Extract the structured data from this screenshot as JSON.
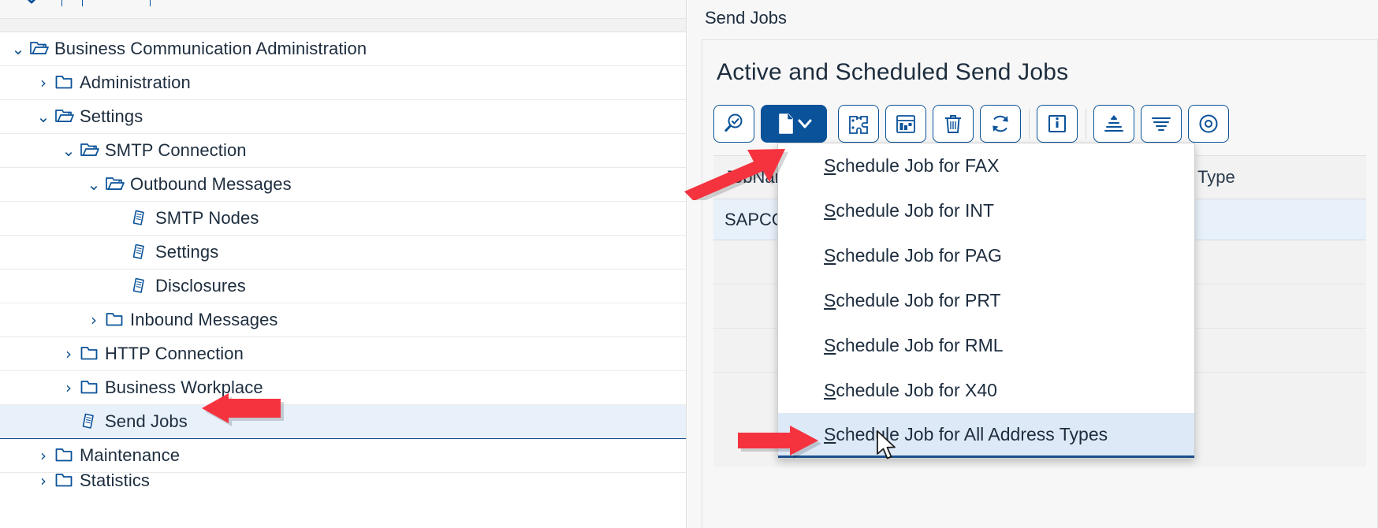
{
  "tree_toolbar": {
    "icons": [
      {
        "name": "collapse-all-icon",
        "glyph": "⌄"
      },
      {
        "name": "expand-all-icon",
        "glyph": "⌃"
      }
    ]
  },
  "tree": {
    "items": [
      {
        "label": "Business Communication Administration",
        "depth": 0,
        "twisty": "⌄",
        "icon": "open-folder",
        "selected": false
      },
      {
        "label": "Administration",
        "depth": 1,
        "twisty": "›",
        "icon": "closed-folder",
        "selected": false
      },
      {
        "label": "Settings",
        "depth": 1,
        "twisty": "⌄",
        "icon": "open-folder",
        "selected": false
      },
      {
        "label": "SMTP Connection",
        "depth": 2,
        "twisty": "⌄",
        "icon": "open-folder",
        "selected": false
      },
      {
        "label": "Outbound Messages",
        "depth": 3,
        "twisty": "⌄",
        "icon": "open-folder",
        "selected": false
      },
      {
        "label": "SMTP Nodes",
        "depth": 4,
        "twisty": "",
        "icon": "document",
        "selected": false
      },
      {
        "label": "Settings",
        "depth": 4,
        "twisty": "",
        "icon": "document",
        "selected": false
      },
      {
        "label": "Disclosures",
        "depth": 4,
        "twisty": "",
        "icon": "document",
        "selected": false
      },
      {
        "label": "Inbound Messages",
        "depth": 3,
        "twisty": "›",
        "icon": "closed-folder",
        "selected": false
      },
      {
        "label": "HTTP Connection",
        "depth": 2,
        "twisty": "›",
        "icon": "closed-folder",
        "selected": false
      },
      {
        "label": "Business Workplace",
        "depth": 2,
        "twisty": "›",
        "icon": "closed-folder",
        "selected": false
      },
      {
        "label": "Send Jobs",
        "depth": 2,
        "twisty": "",
        "icon": "document",
        "selected": true
      },
      {
        "label": "Maintenance",
        "depth": 1,
        "twisty": "›",
        "icon": "closed-folder",
        "selected": false
      },
      {
        "label": "Statistics",
        "depth": 1,
        "twisty": "›",
        "icon": "closed-folder",
        "selected": false
      }
    ]
  },
  "right": {
    "header_title": "Send Jobs",
    "card_title": "Active and Scheduled Send Jobs",
    "toolbar": [
      {
        "name": "search-approve-icon",
        "title": "Display Job"
      },
      {
        "name": "create-job-icon",
        "title": "Create Job",
        "primary": true,
        "has_chevron": true,
        "focused": true
      },
      {
        "name": "puzzle-settings-icon",
        "title": "Job Definition"
      },
      {
        "name": "calendar-icon",
        "title": "Job Overview"
      },
      {
        "name": "delete-icon",
        "title": "Delete"
      },
      {
        "name": "refresh-icon",
        "title": "Refresh"
      },
      {
        "name": "info-icon",
        "title": "Information",
        "sep_before": true
      },
      {
        "name": "sort-icon",
        "title": "Sort",
        "sep_before": true
      },
      {
        "name": "filter-icon",
        "title": "Filter"
      },
      {
        "name": "settings-circle-icon",
        "title": "Settings"
      }
    ],
    "table": {
      "columns": [
        "JobName",
        "Type"
      ],
      "rows": [
        {
          "JobName": "SAPCONNECT",
          "Type": ""
        }
      ]
    }
  },
  "menu": {
    "items": [
      {
        "accesskey": "S",
        "rest": "chedule Job for FAX",
        "highlighted": false
      },
      {
        "accesskey": "S",
        "rest": "chedule Job for INT",
        "highlighted": false
      },
      {
        "accesskey": "S",
        "rest": "chedule Job for PAG",
        "highlighted": false
      },
      {
        "accesskey": "S",
        "rest": "chedule Job for PRT",
        "highlighted": false
      },
      {
        "accesskey": "S",
        "rest": "chedule Job for RML",
        "highlighted": false
      },
      {
        "accesskey": "S",
        "rest": "chedule Job for X40",
        "highlighted": false
      },
      {
        "accesskey": "S",
        "rest": "chedule Job for All Address Types",
        "highlighted": true
      }
    ]
  },
  "annotations": {
    "arrow_color": "#f5333f",
    "arrows": [
      {
        "name": "arrow-to-create-job-button"
      },
      {
        "name": "arrow-to-send-jobs-tree-item"
      },
      {
        "name": "arrow-to-all-address-types-menu-item"
      }
    ]
  },
  "colors": {
    "accent": "#0a5299",
    "selection": "#e8f0fa",
    "menu_highlight": "#dde9f7",
    "panel_bg": "#f7f7f7"
  }
}
